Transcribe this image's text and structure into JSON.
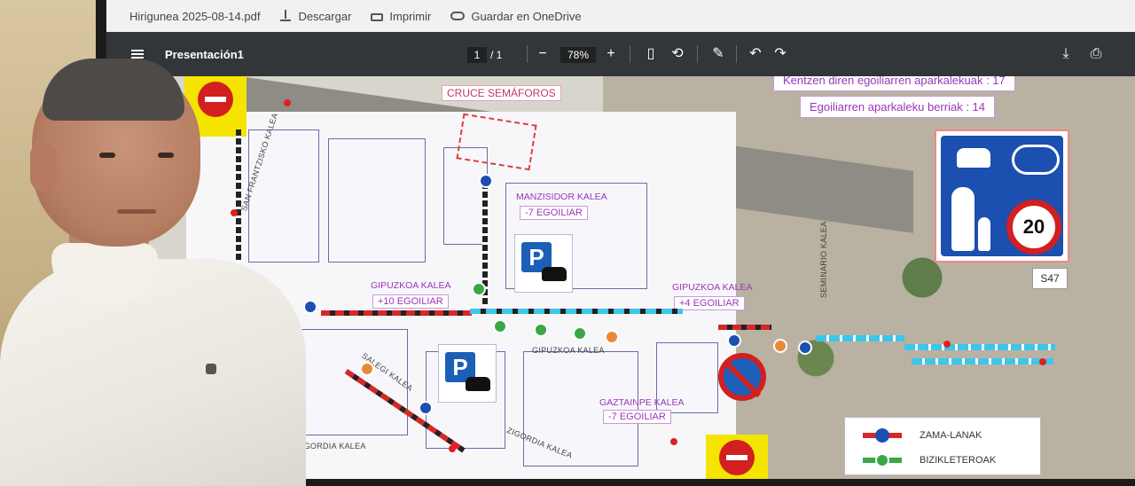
{
  "browser_bar": {
    "filename": "Hirigunea 2025-08-14.pdf",
    "download": "Descargar",
    "print": "Imprimir",
    "save_onedrive": "Guardar en OneDrive"
  },
  "pdf_toolbar": {
    "title": "Presentación1",
    "page_current": "1",
    "page_total": "/ 1",
    "zoom": "78%",
    "zoom_out": "−",
    "zoom_in": "+"
  },
  "map": {
    "cruce": "CRUCE SEMÁFOROS",
    "info_top": "Kentzen diren egoiliarren aparkalekuak : 17",
    "info_new": "Egoiliarren aparkaleku berriak : 14",
    "manzisidor_street": "MANZISIDOR KALEA",
    "manzisidor_change": "-7 EGOILIAR",
    "gipuzkoa_left_street": "GIPUZKOA KALEA",
    "gipuzkoa_left_change": "+10 EGOILIAR",
    "gipuzkoa_right_street": "GIPUZKOA KALEA",
    "gipuzkoa_right_change": "+4 EGOILIAR",
    "gipuzkoa_center": "GIPUZKOA KALEA",
    "gaztainpe_street": "GAZTAINPE KALEA",
    "gaztainpe_change": "-7 EGOILIAR",
    "san_frantzisko": "SAN FRANTZISKO KALEA",
    "salegi": "SALEGI KALEA",
    "zigordia": "ZIGORDIA KALEA",
    "zigordia_left": "ZIGORDIA KALEA",
    "seminario": "SEMINARIO KALEA",
    "speed_limit": "20",
    "sign_code": "S47"
  },
  "legend": {
    "zama": "ZAMA-LANAK",
    "bizikleta": "BIZIKLETEROAK"
  },
  "colors": {
    "accent_purple": "#9b35b9",
    "parking_blue": "#1b5fb8",
    "sign_red": "#d21f1f",
    "bike_lane_blue": "#3cc6ea"
  }
}
